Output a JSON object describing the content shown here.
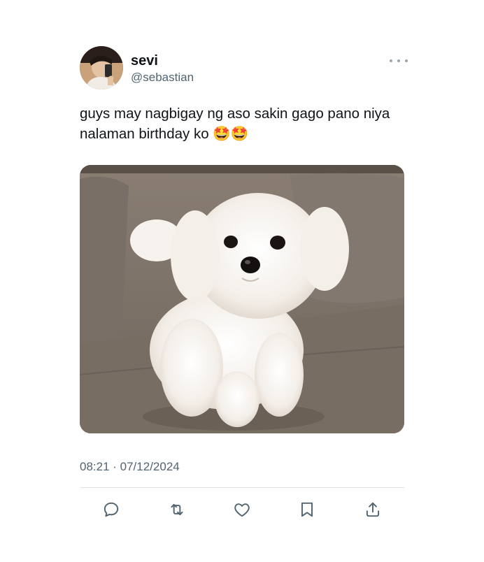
{
  "author": {
    "display_name": "sevi",
    "handle": "@sebastian",
    "avatar_icon": "avatar-photo"
  },
  "tweet": {
    "text": "guys may nagbigay ng aso sakin gago pano niya nalaman birthday ko 🤩🤩",
    "timestamp": "08:21 · 07/12/2024",
    "media_description_icon": "photo-white-puppy-on-couch"
  },
  "actions": {
    "reply_icon": "reply-icon",
    "retweet_icon": "retweet-icon",
    "like_icon": "heart-icon",
    "bookmark_icon": "bookmark-icon",
    "share_icon": "share-icon"
  },
  "colors": {
    "text": "#0f1419",
    "secondary": "#536471",
    "icon": "#536471",
    "divider": "#dfe4e8"
  }
}
